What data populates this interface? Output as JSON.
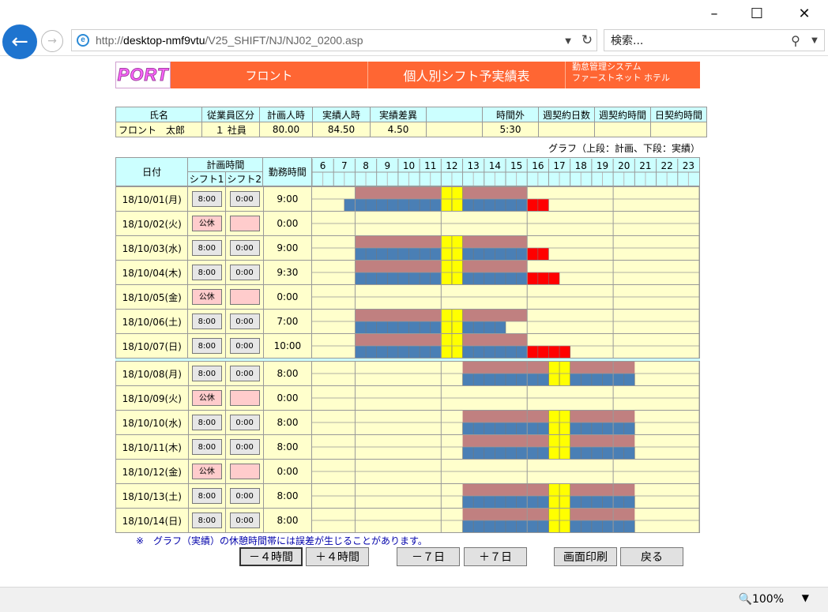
{
  "browser": {
    "url_prefix": "http://",
    "url_host": "desktop-nmf9vtu",
    "url_path": "/V25_SHIFT/NJ/NJ02_0200.asp",
    "search_placeholder": "検索...",
    "zoom": "100%"
  },
  "header": {
    "logo": "PORT",
    "dept": "フロント",
    "title": "個人別シフト予実績表",
    "sys_line1": "勤怠管理システム",
    "sys_line2": "ファーストネット ホテル"
  },
  "summary": {
    "headers": [
      "氏名",
      "従業員区分",
      "計画人時",
      "実績人時",
      "実績差異",
      "",
      "時間外",
      "週契約日数",
      "週契約時間",
      "日契約時間"
    ],
    "values": [
      "フロント　太郎",
      "１ 社員",
      "80.00",
      "84.50",
      "4.50",
      "",
      "5:30",
      "",
      "",
      ""
    ]
  },
  "graph_note": "グラフ（上段：計画、下段：実績）",
  "grid_header": {
    "date": "日付",
    "plan_time": "計画時間",
    "shift1": "シフト1",
    "shift2": "シフト2",
    "work_time": "勤務時間",
    "hours": [
      "6",
      "7",
      "8",
      "9",
      "10",
      "11",
      "12",
      "13",
      "14",
      "15",
      "16",
      "17",
      "18",
      "19",
      "20",
      "21",
      "22",
      "23"
    ]
  },
  "colors": {
    "plan": "#c08080",
    "actual": "#4a7fb5",
    "break": "#ffff00",
    "overtime": "#ff0000",
    "bg": "#ffffcc"
  },
  "weeks": [
    [
      {
        "date": "18/10/01(月)",
        "s1": "8:00",
        "s2": "0:00",
        "hours": "9:00",
        "off": false,
        "plan": [
          8,
          16
        ],
        "brk": [
          12,
          13
        ],
        "act": [
          7.5,
          16
        ],
        "ot": [
          16,
          17
        ]
      },
      {
        "date": "18/10/02(火)",
        "s1": "公休",
        "s2": "",
        "hours": "0:00",
        "off": true
      },
      {
        "date": "18/10/03(水)",
        "s1": "8:00",
        "s2": "0:00",
        "hours": "9:00",
        "off": false,
        "plan": [
          8,
          16
        ],
        "brk": [
          12,
          13
        ],
        "act": [
          8,
          16
        ],
        "ot": [
          16,
          17
        ]
      },
      {
        "date": "18/10/04(木)",
        "s1": "8:00",
        "s2": "0:00",
        "hours": "9:30",
        "off": false,
        "plan": [
          8,
          16
        ],
        "brk": [
          12,
          13
        ],
        "act": [
          8,
          16
        ],
        "ot": [
          16,
          17.5
        ]
      },
      {
        "date": "18/10/05(金)",
        "s1": "公休",
        "s2": "",
        "hours": "0:00",
        "off": true
      },
      {
        "date": "18/10/06(土)",
        "s1": "8:00",
        "s2": "0:00",
        "hours": "7:00",
        "off": false,
        "plan": [
          8,
          16
        ],
        "brk": [
          12,
          13
        ],
        "act": [
          8,
          15
        ]
      },
      {
        "date": "18/10/07(日)",
        "s1": "8:00",
        "s2": "0:00",
        "hours": "10:00",
        "off": false,
        "plan": [
          8,
          16
        ],
        "brk": [
          12,
          13
        ],
        "act": [
          8,
          16
        ],
        "ot": [
          16,
          18
        ]
      }
    ],
    [
      {
        "date": "18/10/08(月)",
        "s1": "8:00",
        "s2": "0:00",
        "hours": "8:00",
        "off": false,
        "plan": [
          13,
          21
        ],
        "brk": [
          17,
          18
        ],
        "act": [
          13,
          21
        ]
      },
      {
        "date": "18/10/09(火)",
        "s1": "公休",
        "s2": "",
        "hours": "0:00",
        "off": true
      },
      {
        "date": "18/10/10(水)",
        "s1": "8:00",
        "s2": "0:00",
        "hours": "8:00",
        "off": false,
        "plan": [
          13,
          21
        ],
        "brk": [
          17,
          18
        ],
        "act": [
          13,
          21
        ]
      },
      {
        "date": "18/10/11(木)",
        "s1": "8:00",
        "s2": "0:00",
        "hours": "8:00",
        "off": false,
        "plan": [
          13,
          21
        ],
        "brk": [
          17,
          18
        ],
        "act": [
          13,
          21
        ]
      },
      {
        "date": "18/10/12(金)",
        "s1": "公休",
        "s2": "",
        "hours": "0:00",
        "off": true
      },
      {
        "date": "18/10/13(土)",
        "s1": "8:00",
        "s2": "0:00",
        "hours": "8:00",
        "off": false,
        "plan": [
          13,
          21
        ],
        "brk": [
          17,
          18
        ],
        "act": [
          13,
          21
        ]
      },
      {
        "date": "18/10/14(日)",
        "s1": "8:00",
        "s2": "0:00",
        "hours": "8:00",
        "off": false,
        "plan": [
          13,
          21
        ],
        "brk": [
          17,
          18
        ],
        "act": [
          13,
          21
        ]
      }
    ]
  ],
  "footnote": "※　グラフ（実績）の休憩時間帯には誤差が生じることがあります。",
  "buttons": {
    "minus4h": "－４時間",
    "plus4h": "＋４時間",
    "minus7d": "－７日",
    "plus7d": "＋７日",
    "print": "画面印刷",
    "back": "戻る"
  }
}
